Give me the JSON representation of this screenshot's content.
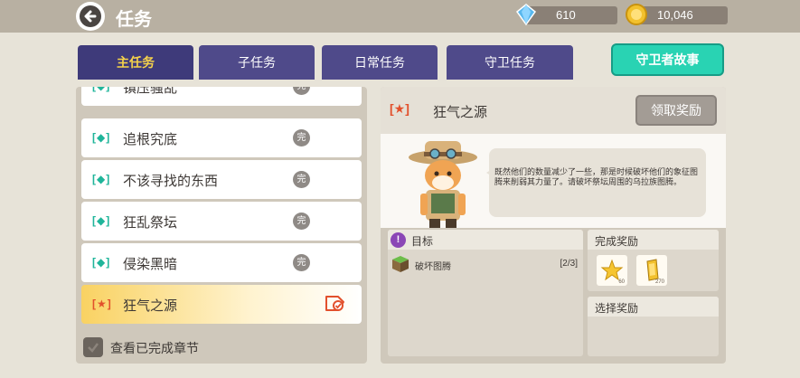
{
  "header": {
    "title": "任务"
  },
  "currency": {
    "gems": "610",
    "coins": "10,046"
  },
  "tabs": [
    {
      "label": "主任务"
    },
    {
      "label": "子任务"
    },
    {
      "label": "日常任务"
    },
    {
      "label": "守卫任务"
    }
  ],
  "story_button": "守卫者故事",
  "quest_list": {
    "items": [
      {
        "icon": "[◆]",
        "name": "镇压骚乱",
        "done": "完"
      },
      {
        "icon": "[◆]",
        "name": "追根究底",
        "done": "完"
      },
      {
        "icon": "[◆]",
        "name": "不该寻找的东西",
        "done": "完"
      },
      {
        "icon": "[◆]",
        "name": "狂乱祭坛",
        "done": "完"
      },
      {
        "icon": "[◆]",
        "name": "侵染黑暗",
        "done": "完"
      },
      {
        "icon": "[★]",
        "name": "狂气之源",
        "done": ""
      }
    ],
    "show_completed_label": "查看已完成章节"
  },
  "detail": {
    "icon": "[★]",
    "title": "狂气之源",
    "claim_button": "领取奖励",
    "dialogue": "既然他们的数量减少了一些，那是时候破坏他们的象征图腾来削弱其力量了。请破坏祭坛周围的乌拉族图腾。",
    "goal_label": "目标",
    "goal_item": "破坏图腾",
    "goal_progress": "[2/3]",
    "reward_label": "完成奖励",
    "reward_1_count": "60",
    "reward_2_count": "270",
    "choose_label": "选择奖励"
  },
  "colors": {
    "accent_tab": "#3e3a7a",
    "story_button": "#29d3b3",
    "active_quest": "#f9d262"
  }
}
